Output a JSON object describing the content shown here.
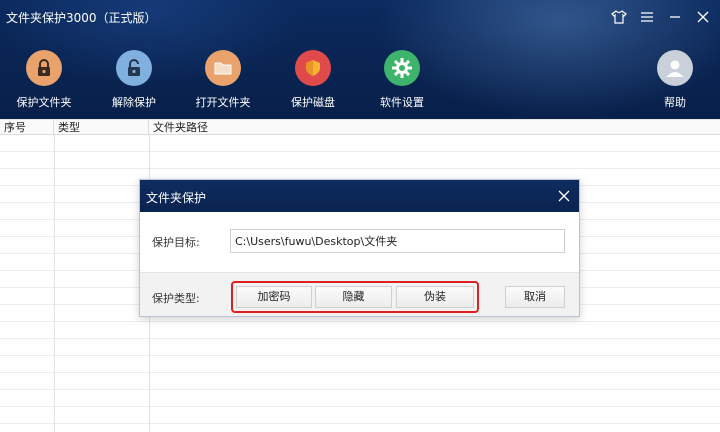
{
  "window": {
    "title": "文件夹保护3000（正式版）"
  },
  "toolbar": {
    "items": [
      {
        "label": "保护文件夹",
        "icon": "lock-icon",
        "color": "#e9a26c"
      },
      {
        "label": "解除保护",
        "icon": "unlock-icon",
        "color": "#7fb0e0"
      },
      {
        "label": "打开文件夹",
        "icon": "folder-icon",
        "color": "#e9a26c"
      },
      {
        "label": "保护磁盘",
        "icon": "shield-icon",
        "color": "#e14a4a"
      },
      {
        "label": "软件设置",
        "icon": "gear-icon",
        "color": "#3db36b"
      },
      {
        "label": "帮助",
        "icon": "user-icon",
        "color": "#c9d0da"
      }
    ]
  },
  "table": {
    "columns": [
      "序号",
      "类型",
      "文件夹路径"
    ]
  },
  "dialog": {
    "title": "文件夹保护",
    "target_label": "保护目标:",
    "target_value": "C:\\Users\\fuwu\\Desktop\\文件夹",
    "type_label": "保护类型:",
    "buttons": [
      "加密码",
      "隐藏",
      "伪装"
    ],
    "cancel": "取消",
    "highlight_color": "#e02020"
  }
}
